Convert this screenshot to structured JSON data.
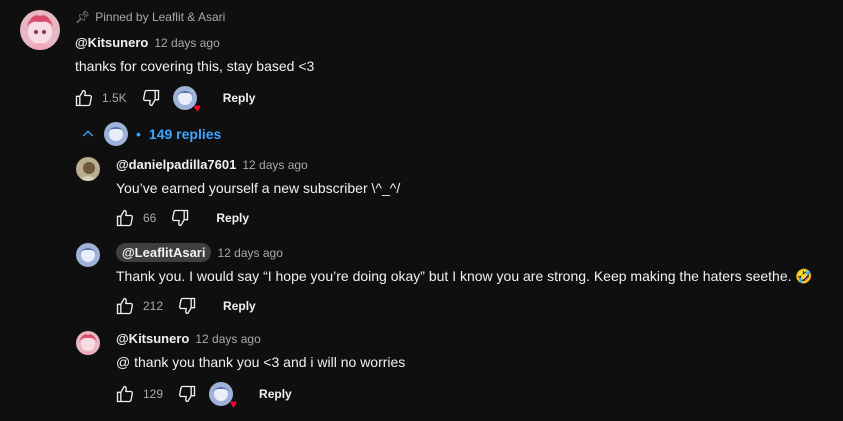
{
  "pinned": {
    "label": "Pinned by Leaflit & Asari"
  },
  "main_comment": {
    "author": "@Kitsunero",
    "time": "12 days ago",
    "text": "thanks for covering this, stay based <3",
    "likes": "1.5K",
    "reply_label": "Reply"
  },
  "replies_toggle": {
    "label": "149 replies"
  },
  "replies": [
    {
      "author": "@danielpadilla7601",
      "time": "12 days ago",
      "text": "You’ve earned yourself a new subscriber \\^_^/",
      "likes": "66",
      "reply_label": "Reply"
    },
    {
      "author": "@LeaflitAsari",
      "time": "12 days ago",
      "text": "Thank you.  I would say “I hope you’re doing okay” but I know you are strong. Keep making the haters seethe. 🤣",
      "likes": "212",
      "reply_label": "Reply"
    },
    {
      "author": "@Kitsunero",
      "time": "12 days ago",
      "text": "@ thank you thank you <3 and i will no worries",
      "likes": "129",
      "reply_label": "Reply"
    }
  ],
  "icons": {
    "like": "thumbs-up-icon",
    "dislike": "thumbs-down-icon",
    "pin": "pin-icon",
    "heart": "heart-icon",
    "chevron": "chevron-up-icon"
  },
  "colors": {
    "background": "#0f0f0f",
    "link": "#3ea6ff",
    "heart": "#ff0033",
    "muted": "#aaaaaa"
  }
}
